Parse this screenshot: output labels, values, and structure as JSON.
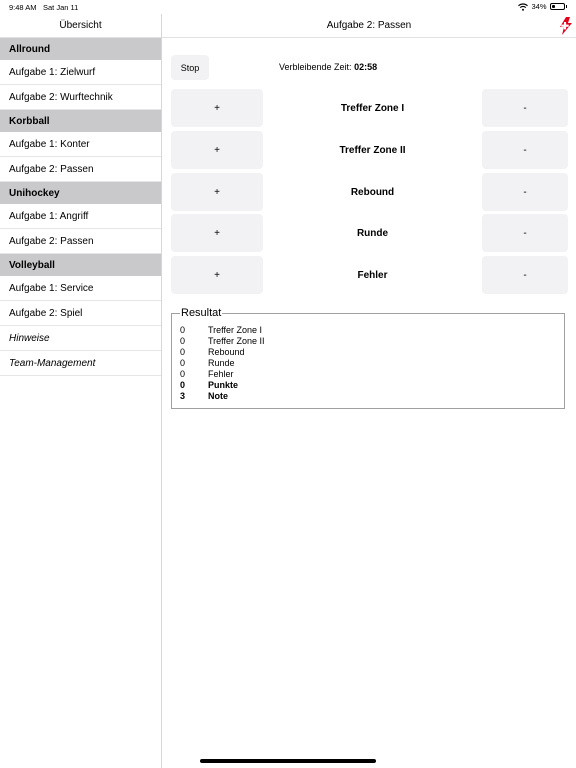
{
  "status": {
    "time": "9:48 AM",
    "date": "Sat Jan 11",
    "battery": "34%",
    "battery_level": 0.34
  },
  "sidebar": {
    "title": "Übersicht",
    "groups": [
      {
        "section": "Allround",
        "items": [
          "Aufgabe 1: Zielwurf",
          "Aufgabe 2: Wurftechnik"
        ]
      },
      {
        "section": "Korbball",
        "items": [
          "Aufgabe 1: Konter",
          "Aufgabe 2: Passen"
        ]
      },
      {
        "section": "Unihockey",
        "items": [
          "Aufgabe 1: Angriff",
          "Aufgabe 2: Passen"
        ]
      },
      {
        "section": "Volleyball",
        "items": [
          "Aufgabe 1: Service",
          "Aufgabe 2: Spiel"
        ]
      }
    ],
    "extra": [
      "Hinweise",
      "Team-Management"
    ]
  },
  "main": {
    "title": "Aufgabe 2: Passen",
    "stop_label": "Stop",
    "timer_label": "Verbleibende Zeit:",
    "timer_value": "02:58",
    "plus_label": "+",
    "minus_label": "-",
    "counters": [
      "Treffer Zone I",
      "Treffer Zone II",
      "Rebound",
      "Runde",
      "Fehler"
    ]
  },
  "resultat": {
    "legend": "Resultat",
    "rows": [
      {
        "value": "0",
        "label": "Treffer Zone I",
        "bold": false
      },
      {
        "value": "0",
        "label": "Treffer Zone II",
        "bold": false
      },
      {
        "value": "0",
        "label": "Rebound",
        "bold": false
      },
      {
        "value": "0",
        "label": "Runde",
        "bold": false
      },
      {
        "value": "0",
        "label": "Fehler",
        "bold": false
      },
      {
        "value": "0",
        "label": "Punkte",
        "bold": true
      },
      {
        "value": "3",
        "label": "Note",
        "bold": true
      }
    ]
  },
  "colors": {
    "logo_red": "#e2001a",
    "section_bg": "#c9c9cc",
    "button_bg": "#f2f2f4"
  }
}
